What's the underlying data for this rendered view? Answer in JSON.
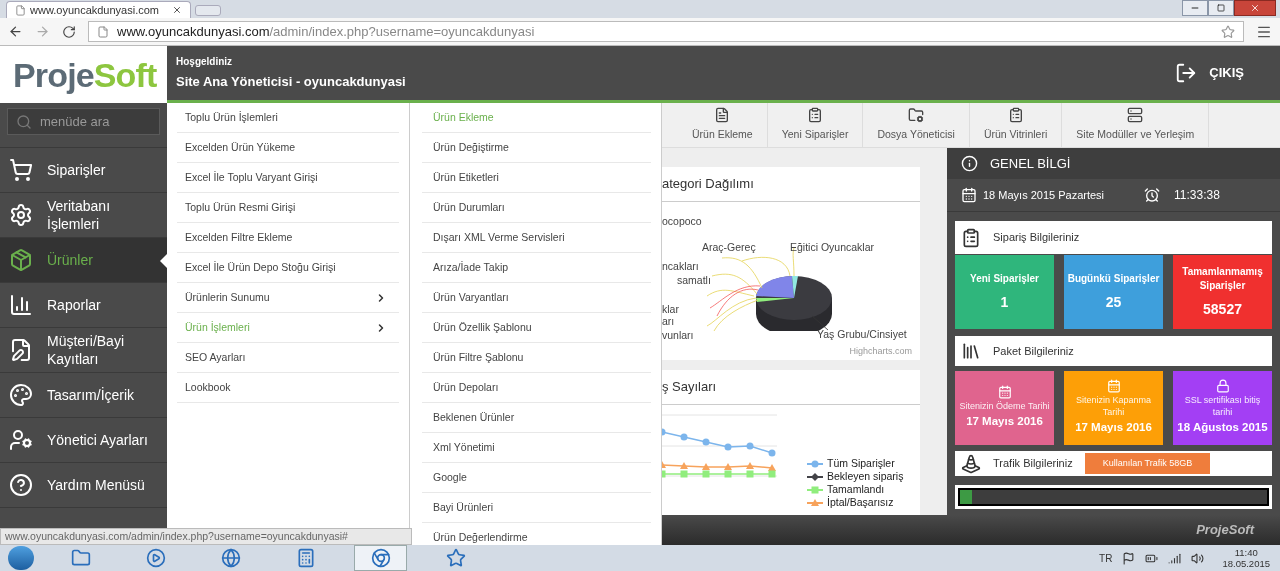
{
  "browser": {
    "tab_title": "www.oyuncakdunyasi.com",
    "url_host": "www.oyuncakdunyasi.com",
    "url_path": "/admin/index.php?username=oyuncakdunyasi"
  },
  "header": {
    "logo_left": "Proje",
    "logo_right": "Soft",
    "greeting": "Hoşgeldiniz",
    "user": "Site Ana Yöneticisi - oyuncakdunyasi",
    "logout": "ÇIKIŞ"
  },
  "sidebar": {
    "search": {
      "placeholder": "menüde ara"
    },
    "items": [
      {
        "label": "Siparişler",
        "selected": false
      },
      {
        "label": "Veritabanı İşlemleri",
        "selected": false
      },
      {
        "label": "Ürünler",
        "selected": true
      },
      {
        "label": "Raporlar",
        "selected": false
      },
      {
        "label": "Müşteri/Bayi Kayıtları",
        "selected": false
      },
      {
        "label": "Tasarım/İçerik",
        "selected": false
      },
      {
        "label": "Yönetici Ayarları",
        "selected": false
      },
      {
        "label": "Yardım Menüsü",
        "selected": false
      }
    ]
  },
  "submenu": {
    "items": [
      {
        "label": "Toplu Ürün İşlemleri",
        "has_children": false,
        "selected": false
      },
      {
        "label": "Excelden Ürün Yükeme",
        "has_children": false,
        "selected": false
      },
      {
        "label": "Excel İle Toplu Varyant Girişi",
        "has_children": false,
        "selected": false
      },
      {
        "label": "Toplu Ürün Resmi Girişi",
        "has_children": false,
        "selected": false
      },
      {
        "label": "Excelden Filtre Ekleme",
        "has_children": false,
        "selected": false
      },
      {
        "label": "Excel İle Ürün Depo Stoğu Girişi",
        "has_children": false,
        "selected": false
      },
      {
        "label": "Ürünlerin Sunumu",
        "has_children": true,
        "selected": false
      },
      {
        "label": "Ürün İşlemleri",
        "has_children": true,
        "selected": true
      },
      {
        "label": "SEO Ayarları",
        "has_children": false,
        "selected": false
      },
      {
        "label": "Lookbook",
        "has_children": false,
        "selected": false
      }
    ]
  },
  "submenu_2": {
    "items": [
      {
        "label": "Ürün Ekleme",
        "selected": true
      },
      {
        "label": "Ürün Değiştirme",
        "selected": false
      },
      {
        "label": "Ürün Etiketleri",
        "selected": false
      },
      {
        "label": "Ürün Durumları",
        "selected": false
      },
      {
        "label": "Dışarı XML Verme Servisleri",
        "selected": false
      },
      {
        "label": "Arıza/İade Takip",
        "selected": false
      },
      {
        "label": "Ürün Varyantları",
        "selected": false
      },
      {
        "label": "Ürün Özellik Şablonu",
        "selected": false
      },
      {
        "label": "Ürün Filtre Şablonu",
        "selected": false
      },
      {
        "label": "Ürün Depoları",
        "selected": false
      },
      {
        "label": "Beklenen Ürünler",
        "selected": false
      },
      {
        "label": "Xml Yönetimi",
        "selected": false
      },
      {
        "label": "Google",
        "selected": false
      },
      {
        "label": "Bayi Ürünleri",
        "selected": false
      },
      {
        "label": "Ürün Değerlendirme",
        "selected": false
      }
    ]
  },
  "toolbar": [
    "Ürün Ekleme",
    "Yeni Siparişler",
    "Dosya Yöneticisi",
    "Ürün Vitrinleri",
    "Site Modüller ve Yerleşim"
  ],
  "category_chart": {
    "title": "ategori Dağılımı",
    "labels": [
      "ocopoco",
      "Araç-Gereç",
      "Eğitici Oyuncaklar",
      "ncakları",
      "samatlı",
      "klar",
      "arı",
      "vunları",
      "Yaş Grubu/Cinsiyet"
    ],
    "credit": "Highcharts.com"
  },
  "orders_chart": {
    "title": "ş Sayıları",
    "legend": [
      {
        "name": "Tüm Siparişler",
        "color": "#7cb5ec",
        "kind": "circle"
      },
      {
        "name": "Bekleyen sipariş",
        "color": "#434348",
        "kind": "diamond"
      },
      {
        "name": "Tamamlandı",
        "color": "#90ed7d",
        "kind": "square"
      },
      {
        "name": "İptal/Başarısız",
        "color": "#f7a35c",
        "kind": "triangle"
      }
    ]
  },
  "info": {
    "title": "GENEL BİLGİ",
    "date": "18 Mayıs 2015 Pazartesi",
    "time": "11:33:38",
    "orders_title": "Sipariş Bilgileriniz",
    "order_tiles": [
      {
        "label": "Yeni Siparişler",
        "value": "1",
        "color": "#2fb67c"
      },
      {
        "label": "Bugünkü Siparişler",
        "value": "25",
        "color": "#3e9fdc"
      },
      {
        "label": "Tamamlanmamış Siparişler",
        "value": "58527",
        "color": "#f0302f"
      }
    ],
    "package_title": "Paket Bilgileriniz",
    "package_tiles": [
      {
        "label": "Sitenizin Ödeme Tarihi",
        "value": "17 Mayıs 2016",
        "color": "#e0648e"
      },
      {
        "label": "Sitenizin Kapanma Tarihi",
        "value": "17 Mayıs 2016",
        "color": "#fd9f07"
      },
      {
        "label": "SSL sertifikası bitiş tarihi",
        "value": "18 Ağustos 2015",
        "color": "#a33ff4"
      }
    ],
    "traffic_title": "Trafik Bilgileriniz",
    "traffic_badge": "Kullanılan Trafik 58GB",
    "traffic": {
      "level": 0.04
    }
  },
  "footer": "ProjeSoft",
  "status_url": "www.oyuncakdunyasi.com/admin/index.php?username=oyuncakdunyasi#",
  "taskbar": {
    "apps": [
      {
        "selected": false
      },
      {
        "selected": false
      },
      {
        "selected": false
      },
      {
        "selected": false
      },
      {
        "selected": true
      },
      {
        "selected": false
      }
    ],
    "language": "TR",
    "time": "11:40",
    "date": "18.05.2015"
  }
}
